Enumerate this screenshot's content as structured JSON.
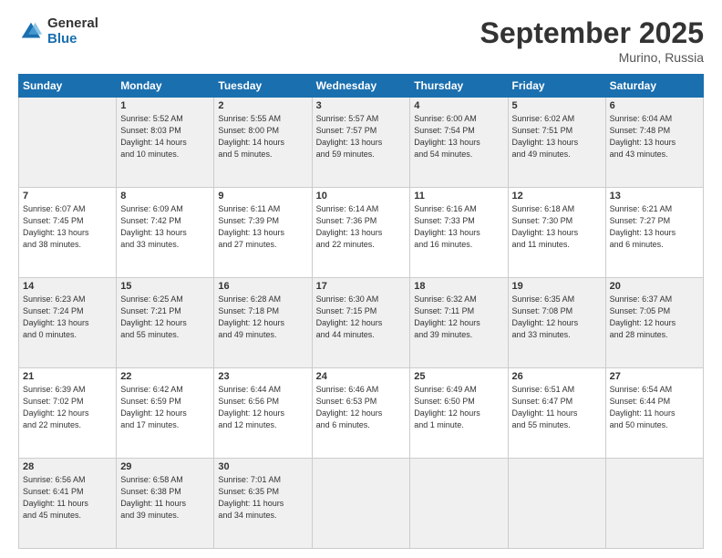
{
  "logo": {
    "general": "General",
    "blue": "Blue"
  },
  "title": {
    "month": "September 2025",
    "location": "Murino, Russia"
  },
  "days_of_week": [
    "Sunday",
    "Monday",
    "Tuesday",
    "Wednesday",
    "Thursday",
    "Friday",
    "Saturday"
  ],
  "weeks": [
    [
      {
        "day": "",
        "info": ""
      },
      {
        "day": "1",
        "info": "Sunrise: 5:52 AM\nSunset: 8:03 PM\nDaylight: 14 hours\nand 10 minutes."
      },
      {
        "day": "2",
        "info": "Sunrise: 5:55 AM\nSunset: 8:00 PM\nDaylight: 14 hours\nand 5 minutes."
      },
      {
        "day": "3",
        "info": "Sunrise: 5:57 AM\nSunset: 7:57 PM\nDaylight: 13 hours\nand 59 minutes."
      },
      {
        "day": "4",
        "info": "Sunrise: 6:00 AM\nSunset: 7:54 PM\nDaylight: 13 hours\nand 54 minutes."
      },
      {
        "day": "5",
        "info": "Sunrise: 6:02 AM\nSunset: 7:51 PM\nDaylight: 13 hours\nand 49 minutes."
      },
      {
        "day": "6",
        "info": "Sunrise: 6:04 AM\nSunset: 7:48 PM\nDaylight: 13 hours\nand 43 minutes."
      }
    ],
    [
      {
        "day": "7",
        "info": "Sunrise: 6:07 AM\nSunset: 7:45 PM\nDaylight: 13 hours\nand 38 minutes."
      },
      {
        "day": "8",
        "info": "Sunrise: 6:09 AM\nSunset: 7:42 PM\nDaylight: 13 hours\nand 33 minutes."
      },
      {
        "day": "9",
        "info": "Sunrise: 6:11 AM\nSunset: 7:39 PM\nDaylight: 13 hours\nand 27 minutes."
      },
      {
        "day": "10",
        "info": "Sunrise: 6:14 AM\nSunset: 7:36 PM\nDaylight: 13 hours\nand 22 minutes."
      },
      {
        "day": "11",
        "info": "Sunrise: 6:16 AM\nSunset: 7:33 PM\nDaylight: 13 hours\nand 16 minutes."
      },
      {
        "day": "12",
        "info": "Sunrise: 6:18 AM\nSunset: 7:30 PM\nDaylight: 13 hours\nand 11 minutes."
      },
      {
        "day": "13",
        "info": "Sunrise: 6:21 AM\nSunset: 7:27 PM\nDaylight: 13 hours\nand 6 minutes."
      }
    ],
    [
      {
        "day": "14",
        "info": "Sunrise: 6:23 AM\nSunset: 7:24 PM\nDaylight: 13 hours\nand 0 minutes."
      },
      {
        "day": "15",
        "info": "Sunrise: 6:25 AM\nSunset: 7:21 PM\nDaylight: 12 hours\nand 55 minutes."
      },
      {
        "day": "16",
        "info": "Sunrise: 6:28 AM\nSunset: 7:18 PM\nDaylight: 12 hours\nand 49 minutes."
      },
      {
        "day": "17",
        "info": "Sunrise: 6:30 AM\nSunset: 7:15 PM\nDaylight: 12 hours\nand 44 minutes."
      },
      {
        "day": "18",
        "info": "Sunrise: 6:32 AM\nSunset: 7:11 PM\nDaylight: 12 hours\nand 39 minutes."
      },
      {
        "day": "19",
        "info": "Sunrise: 6:35 AM\nSunset: 7:08 PM\nDaylight: 12 hours\nand 33 minutes."
      },
      {
        "day": "20",
        "info": "Sunrise: 6:37 AM\nSunset: 7:05 PM\nDaylight: 12 hours\nand 28 minutes."
      }
    ],
    [
      {
        "day": "21",
        "info": "Sunrise: 6:39 AM\nSunset: 7:02 PM\nDaylight: 12 hours\nand 22 minutes."
      },
      {
        "day": "22",
        "info": "Sunrise: 6:42 AM\nSunset: 6:59 PM\nDaylight: 12 hours\nand 17 minutes."
      },
      {
        "day": "23",
        "info": "Sunrise: 6:44 AM\nSunset: 6:56 PM\nDaylight: 12 hours\nand 12 minutes."
      },
      {
        "day": "24",
        "info": "Sunrise: 6:46 AM\nSunset: 6:53 PM\nDaylight: 12 hours\nand 6 minutes."
      },
      {
        "day": "25",
        "info": "Sunrise: 6:49 AM\nSunset: 6:50 PM\nDaylight: 12 hours\nand 1 minute."
      },
      {
        "day": "26",
        "info": "Sunrise: 6:51 AM\nSunset: 6:47 PM\nDaylight: 11 hours\nand 55 minutes."
      },
      {
        "day": "27",
        "info": "Sunrise: 6:54 AM\nSunset: 6:44 PM\nDaylight: 11 hours\nand 50 minutes."
      }
    ],
    [
      {
        "day": "28",
        "info": "Sunrise: 6:56 AM\nSunset: 6:41 PM\nDaylight: 11 hours\nand 45 minutes."
      },
      {
        "day": "29",
        "info": "Sunrise: 6:58 AM\nSunset: 6:38 PM\nDaylight: 11 hours\nand 39 minutes."
      },
      {
        "day": "30",
        "info": "Sunrise: 7:01 AM\nSunset: 6:35 PM\nDaylight: 11 hours\nand 34 minutes."
      },
      {
        "day": "",
        "info": ""
      },
      {
        "day": "",
        "info": ""
      },
      {
        "day": "",
        "info": ""
      },
      {
        "day": "",
        "info": ""
      }
    ]
  ]
}
